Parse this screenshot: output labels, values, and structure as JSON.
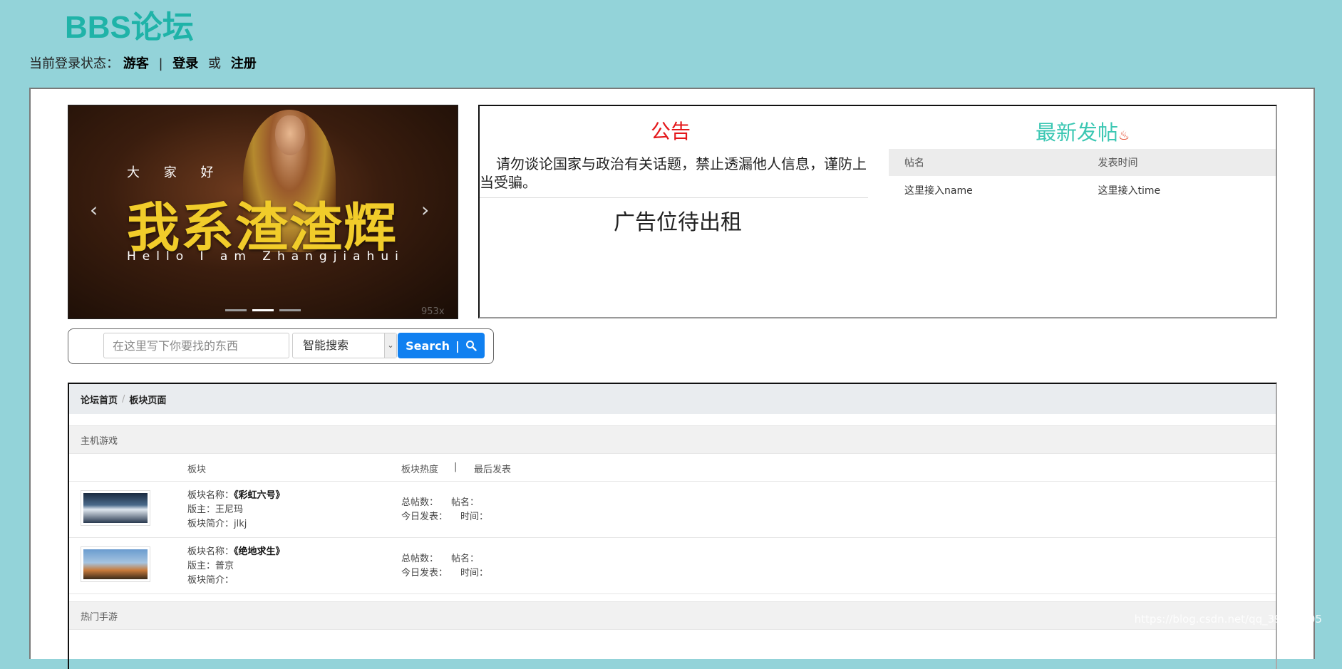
{
  "site": {
    "title": "BBS论坛"
  },
  "login": {
    "prefix": "当前登录状态：",
    "guest": "游客",
    "sep": "|",
    "login_label": "登录",
    "or": "或",
    "register_label": "注册"
  },
  "carousel": {
    "greeting": "大 家 好",
    "headline": "我系渣渣辉",
    "subline": "Hello I am Zhangjiahui",
    "prev_icon": "‹",
    "next_icon": "›",
    "watermark": "953x",
    "slides": 3,
    "active_slide": 2
  },
  "notice": {
    "title": "公告",
    "text": "请勿谈论国家与政治有关话题，禁止透漏他人信息，谨防上当受骗。",
    "ad": "广告位待出租"
  },
  "latest": {
    "title": "最新发帖",
    "icon": "fire-icon",
    "headers": [
      "帖名",
      "发表时间"
    ],
    "rows": [
      [
        "这里接入name",
        "这里接入time"
      ]
    ]
  },
  "search": {
    "placeholder": "在这里写下你要找的东西",
    "mode": "智能搜索",
    "button_label": "Search",
    "button_sep": "|"
  },
  "breadcrumb": {
    "home": "论坛首页",
    "current": "板块页面",
    "sep": "/"
  },
  "sections": [
    {
      "category": "主机游戏",
      "header": {
        "col_board": "板块",
        "col_heat": "板块热度",
        "sep": "|",
        "col_last": "最后发表"
      },
      "boards": [
        {
          "name_label": "板块名称：",
          "name": "《彩虹六号》",
          "moderator_label": "版主：",
          "moderator": "王尼玛",
          "intro_label": "板块简介：",
          "intro": "jlkj",
          "posts_label": "总帖数：",
          "post_name_label": "帖名：",
          "today_label": "今日发表：",
          "time_label": "时间："
        },
        {
          "name_label": "板块名称：",
          "name": "《绝地求生》",
          "moderator_label": "版主：",
          "moderator": "普京",
          "intro_label": "板块简介：",
          "intro": "",
          "posts_label": "总帖数：",
          "post_name_label": "帖名：",
          "today_label": "今日发表：",
          "time_label": "时间："
        }
      ]
    },
    {
      "category": "热门手游"
    }
  ],
  "watermark": "https://blog.csdn.net/qq_39248005"
}
